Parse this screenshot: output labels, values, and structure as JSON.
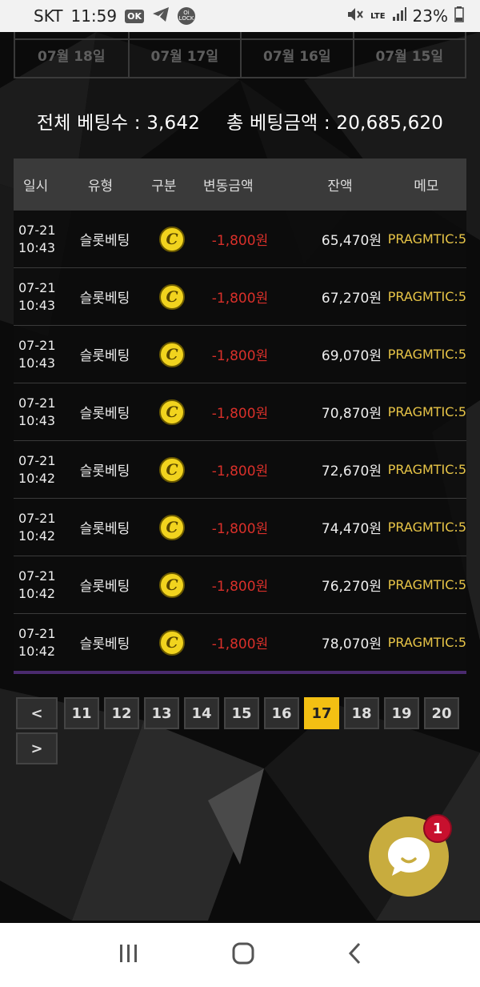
{
  "status_bar": {
    "carrier": "SKT",
    "time": "11:59",
    "ok_badge": "OK",
    "lock_label": "Oi LOCK",
    "network": "LTE",
    "battery": "23%"
  },
  "date_tabs": [
    "07월 18일",
    "07월 17일",
    "07월 16일",
    "07월 15일"
  ],
  "summary": {
    "total_bets_label": "전체 베팅수 :",
    "total_bets_value": "3,642",
    "total_amount_label": "총 베팅금액 :",
    "total_amount_value": "20,685,620"
  },
  "table": {
    "headers": [
      "일시",
      "유형",
      "구분",
      "변동금액",
      "잔액",
      "메모"
    ],
    "rows": [
      {
        "date": "07-21",
        "time": "10:43",
        "type": "슬롯베팅",
        "icon": "coin-icon",
        "change": "-1,800원",
        "balance": "65,470원",
        "memo": "PRAGMTIC:5"
      },
      {
        "date": "07-21",
        "time": "10:43",
        "type": "슬롯베팅",
        "icon": "coin-icon",
        "change": "-1,800원",
        "balance": "67,270원",
        "memo": "PRAGMTIC:5"
      },
      {
        "date": "07-21",
        "time": "10:43",
        "type": "슬롯베팅",
        "icon": "coin-icon",
        "change": "-1,800원",
        "balance": "69,070원",
        "memo": "PRAGMTIC:5"
      },
      {
        "date": "07-21",
        "time": "10:43",
        "type": "슬롯베팅",
        "icon": "coin-icon",
        "change": "-1,800원",
        "balance": "70,870원",
        "memo": "PRAGMTIC:5"
      },
      {
        "date": "07-21",
        "time": "10:42",
        "type": "슬롯베팅",
        "icon": "coin-icon",
        "change": "-1,800원",
        "balance": "72,670원",
        "memo": "PRAGMTIC:5"
      },
      {
        "date": "07-21",
        "time": "10:42",
        "type": "슬롯베팅",
        "icon": "coin-icon",
        "change": "-1,800원",
        "balance": "74,470원",
        "memo": "PRAGMTIC:5"
      },
      {
        "date": "07-21",
        "time": "10:42",
        "type": "슬롯베팅",
        "icon": "coin-icon",
        "change": "-1,800원",
        "balance": "76,270원",
        "memo": "PRAGMTIC:5"
      },
      {
        "date": "07-21",
        "time": "10:42",
        "type": "슬롯베팅",
        "icon": "coin-icon",
        "change": "-1,800원",
        "balance": "78,070원",
        "memo": "PRAGMTIC:5"
      }
    ]
  },
  "coin_glyph": "C",
  "pagination": {
    "prev": "<",
    "next": ">",
    "pages": [
      "11",
      "12",
      "13",
      "14",
      "15",
      "16",
      "17",
      "18",
      "19",
      "20"
    ],
    "active": "17"
  },
  "chat": {
    "icon": "chat-bubble-icon",
    "badge": "1"
  },
  "nav": {
    "recents_icon": "recents-icon",
    "home_icon": "home-icon",
    "back_icon": "back-icon"
  },
  "colors": {
    "negative": "#d9302a",
    "memo": "#e8c547",
    "active_page": "#f3c013",
    "chat_button": "#c8ac3e",
    "badge": "#c8102e"
  }
}
